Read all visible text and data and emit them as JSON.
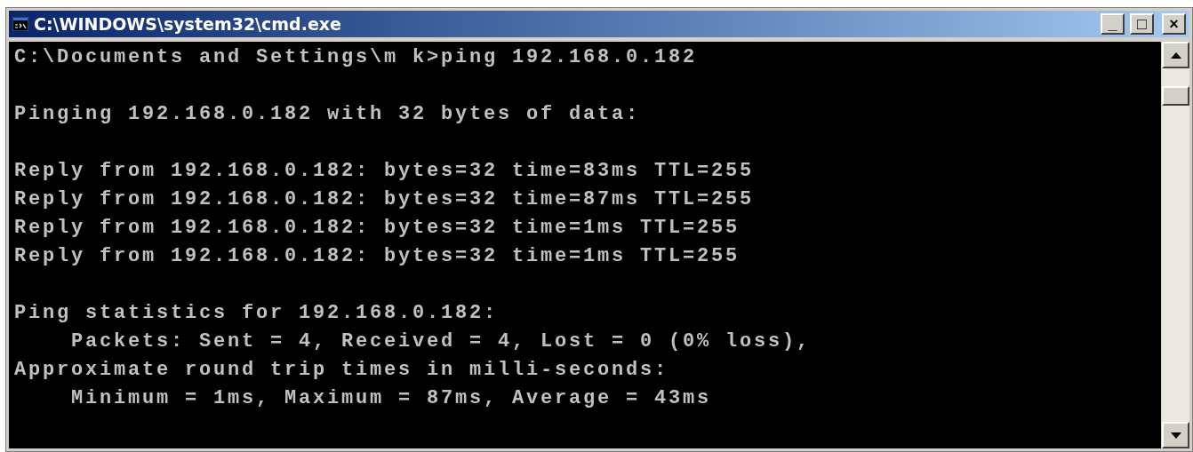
{
  "window": {
    "title": "C:\\WINDOWS\\system32\\cmd.exe",
    "controls": [
      "_",
      "□",
      "×"
    ]
  },
  "console": {
    "blocks": [
      [
        "C:\\Documents and Settings\\m k>ping 192.168.0.182"
      ],
      [
        "Pinging 192.168.0.182 with 32 bytes of data:"
      ],
      [
        "Reply from 192.168.0.182: bytes=32 time=83ms TTL=255",
        "Reply from 192.168.0.182: bytes=32 time=87ms TTL=255",
        "Reply from 192.168.0.182: bytes=32 time=1ms TTL=255",
        "Reply from 192.168.0.182: bytes=32 time=1ms TTL=255"
      ],
      [
        "Ping statistics for 192.168.0.182:",
        "    Packets: Sent = 4, Received = 4, Lost = 0 (0% loss),",
        "Approximate round trip times in milli-seconds:",
        "    Minimum = 1ms, Maximum = 87ms, Average = 43ms"
      ]
    ]
  }
}
